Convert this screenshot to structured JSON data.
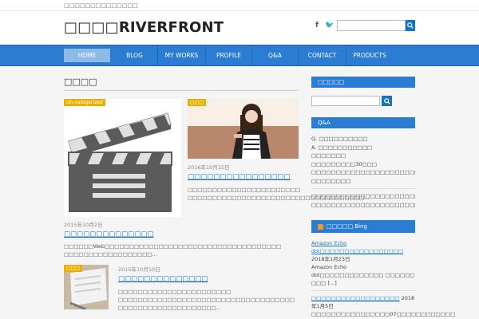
{
  "site": {
    "tagline": "□□□□□□□□□□□□□□",
    "logo": "□□□□RIVERFRONT",
    "social": [
      "f",
      "🐦"
    ]
  },
  "nav": {
    "items": [
      "HOME",
      "BLOG",
      "MY WORKS",
      "PROFILE",
      "Q&A",
      "CONTACT",
      "PRODUCTS"
    ],
    "active_index": 0
  },
  "page": {
    "title": "□□□□"
  },
  "posts": [
    {
      "badge": "Un-categorized",
      "date": "2015年10月2日",
      "title": "□□□□□□□□□□□□□□",
      "excerpt": "□□□□□□Web□□□□□□□□□□□□□□□□□□□□□□□□□□□□□□□□□□□□ □□□□□□□□□□□□□□□□□□..."
    },
    {
      "badge": "□□□",
      "date": "2016年10月25日",
      "title": "□□□□□□□□□□□□□□□□",
      "excerpt": "□□□□□□□□□□□□□□□□□□□□□□□ □□□□□□□□□□□□□□□□□□□□□□□□□□□□□□□□□□□□..."
    },
    {
      "badge": "□□□",
      "date": "2015年10月10日",
      "title": "□□□□□□□□□□□□□□",
      "excerpt": "□□□□□□□□□□□□□□□□□□□□□□□ □□□□□□□□□□□□□□□□□□□□□□□□□□□□□□□□□□□□ □□□□□□□□□□□□□□□□□□□□..."
    }
  ],
  "sidebar": {
    "search_head": "□□□□□",
    "qa_head": "Q&A",
    "qa_lines": [
      "Q. □□□□□□□□□□",
      "A. □□□□□□□□□□□",
      "□□□□□□□",
      "□□□□□□□□□30□□□",
      "□□□□□□□□□□□□□□□□□□□□□□□□□□□□□□",
      "□□□□□□□□",
      "□□□□□□□□□□□□□□□□□□□□□□□□□□□□□□□",
      "□□□□□□□□□□□□□□□□□□□□□□□□□□□□□□"
    ],
    "rss_head": "□□□□□ Bing",
    "rss_items": [
      {
        "link": "Amazon Echo dot□□□□□□□□□□□□□□□□□",
        "meta": " 2018年1月23日",
        "text": "Amazon Echo dot□□□□□□□□□□□□□ □□□□□□ □□□ [...]"
      },
      {
        "link": "□□□□□□□□□□□□□□□□□□",
        "meta": " 2018年1月5日",
        "text": "□□□□□□□□□□□□□□□□07□□□□□□□□□□□□ □□□ ... Copyright [...]"
      }
    ]
  },
  "colors": {
    "nav": "#2b7cd3",
    "accent": "#1a73c1",
    "badge": "#e8b100"
  }
}
